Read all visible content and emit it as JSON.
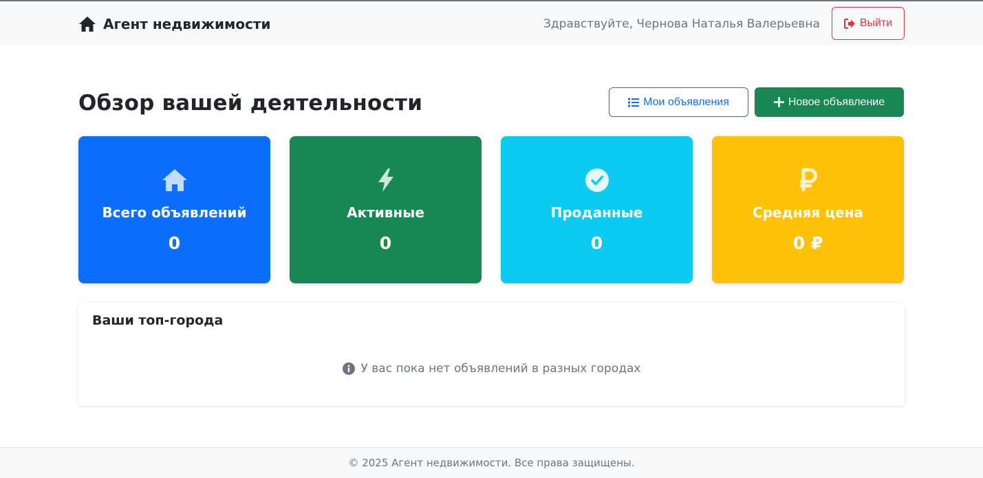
{
  "navbar": {
    "brand": "Агент недвижимости",
    "brand_icon": "house-icon",
    "greeting": "Здравствуйте, Чернова Наталья Валерьевна",
    "logout_label": "Выйти",
    "logout_icon": "sign-out-icon"
  },
  "main": {
    "title": "Обзор вашей деятельности",
    "my_listings_label": "Мои объявления",
    "my_listings_icon": "list-icon",
    "new_listing_label": "Новое объявление",
    "new_listing_icon": "plus-icon"
  },
  "stats": [
    {
      "label": "Всего объявлений",
      "value": "0",
      "icon": "house-icon",
      "color": "#0d6efd"
    },
    {
      "label": "Активные",
      "value": "0",
      "icon": "bolt-icon",
      "color": "#198754"
    },
    {
      "label": "Проданные",
      "value": "0",
      "icon": "check-circle-icon",
      "color": "#0dcaf0"
    },
    {
      "label": "Средняя цена",
      "value": "0 ₽",
      "icon": "ruble-icon",
      "color": "#ffc107"
    }
  ],
  "top_cities": {
    "title": "Ваши топ-города",
    "empty_message": "У вас пока нет объявлений в разных городах",
    "info_icon": "info-circle-icon"
  },
  "footer": {
    "text": "© 2025 Агент недвижимости. Все права защищены."
  }
}
